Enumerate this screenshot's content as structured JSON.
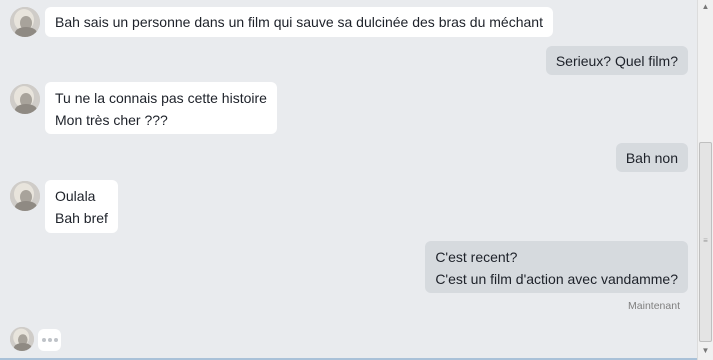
{
  "messages": [
    {
      "direction": "in",
      "lines": [
        "Bah sais un personne dans un film qui sauve sa dulcinée des bras du méchant"
      ]
    },
    {
      "direction": "out",
      "lines": [
        "Serieux? Quel film?"
      ]
    },
    {
      "direction": "in",
      "lines": [
        "Tu ne la connais pas cette histoire",
        "Mon très cher ???"
      ]
    },
    {
      "direction": "out",
      "lines": [
        "Bah non"
      ]
    },
    {
      "direction": "in",
      "lines": [
        "Oulala",
        "Bah bref"
      ]
    },
    {
      "direction": "out",
      "lines": [
        "C'est recent?",
        "C'est un film d'action avec vandamme?"
      ]
    }
  ],
  "status": {
    "timestamp": "Maintenant"
  },
  "typing_indicator": {
    "icon": "typing-dots-icon"
  },
  "colors": {
    "incoming_bubble": "#ffffff",
    "outgoing_bubble": "#d6dade",
    "background": "#e9ebee"
  }
}
